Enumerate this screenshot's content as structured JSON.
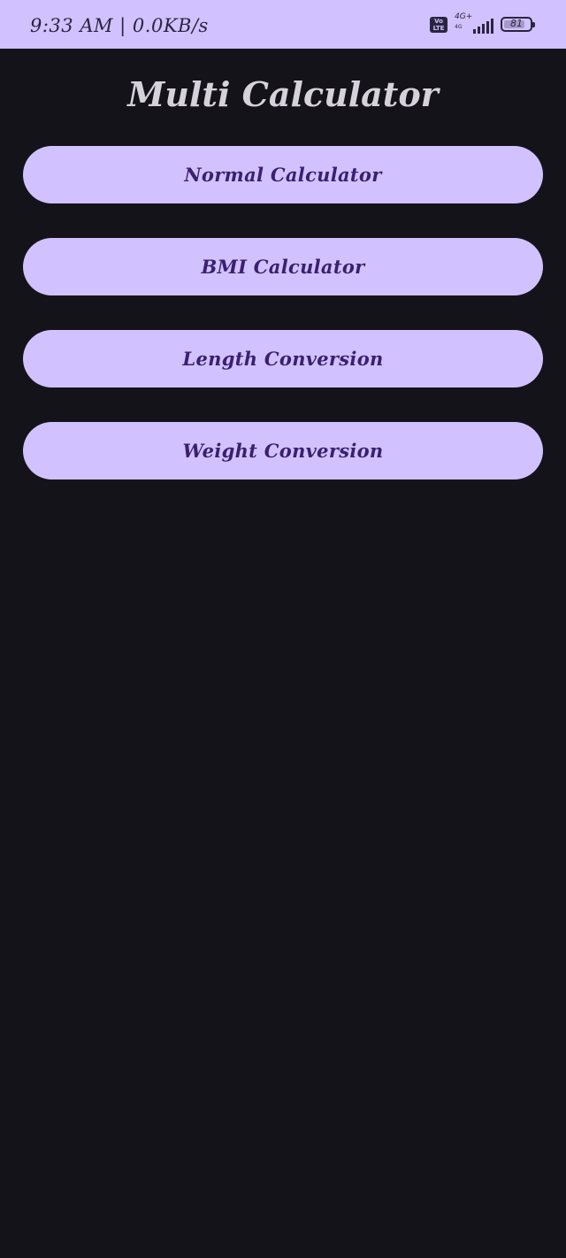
{
  "status_bar": {
    "time_speed": "9:33 AM | 0.0KB/s",
    "volte": "Vo LTE",
    "network_type": "4G+",
    "network_sub": "4G",
    "signal_level": 5,
    "battery": "81",
    "battery_level": 0.81
  },
  "app": {
    "title": "Multi Calculator"
  },
  "menu": [
    {
      "label": "Normal Calculator"
    },
    {
      "label": "BMI Calculator"
    },
    {
      "label": "Length Conversion"
    },
    {
      "label": "Weight Conversion"
    }
  ],
  "colors": {
    "background": "#15131a",
    "accent": "#d1c2ff",
    "button_text": "#3b1f70",
    "title_text": "#d6d2dc"
  }
}
